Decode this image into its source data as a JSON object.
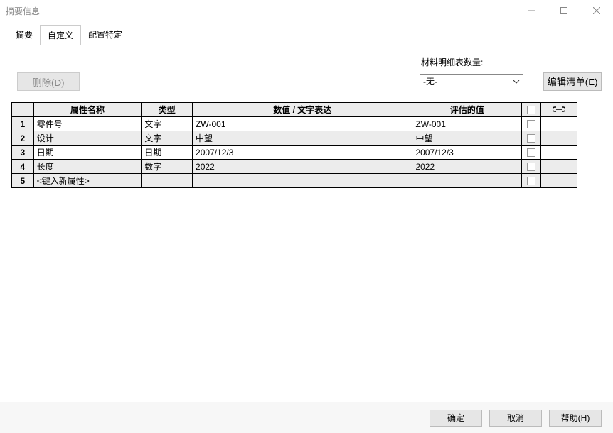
{
  "window": {
    "title": "摘要信息"
  },
  "tabs": {
    "summary": "摘要",
    "custom": "自定义",
    "config": "配置特定"
  },
  "toolbar": {
    "delete_label": "删除(D)",
    "bom_count_label": "材料明细表数量:",
    "bom_selected": "-无-",
    "edit_list_label": "编辑清单(E)"
  },
  "headers": {
    "name": "属性名称",
    "type": "类型",
    "value": "数值 / 文字表达",
    "eval": "评估的值"
  },
  "rows": [
    {
      "n": "1",
      "name": "零件号",
      "type": "文字",
      "value": " ZW-001",
      "eval": " ZW-001"
    },
    {
      "n": "2",
      "name": "设计",
      "type": "文字",
      "value": "中望",
      "eval": "中望"
    },
    {
      "n": "3",
      "name": "日期",
      "type": "日期",
      "value": "2007/12/3",
      "eval": "2007/12/3"
    },
    {
      "n": "4",
      "name": "长度",
      "type": "数字",
      "value": "2022",
      "eval": "2022"
    },
    {
      "n": "5",
      "name": "<键入新属性>",
      "type": "",
      "value": "",
      "eval": ""
    }
  ],
  "footer": {
    "ok": "确定",
    "cancel": "取消",
    "help": "帮助(H)"
  }
}
